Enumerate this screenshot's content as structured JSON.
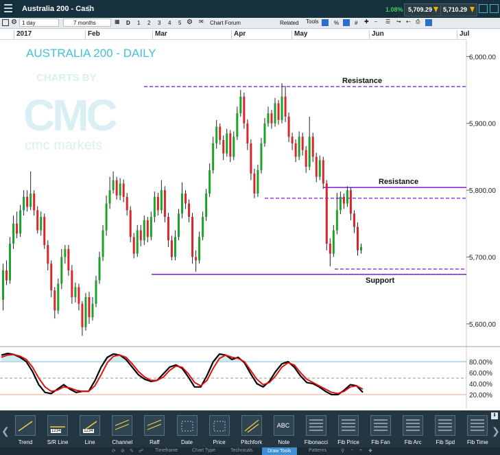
{
  "header": {
    "title": "Australia 200 - Cash",
    "change": "1.08%",
    "sell_price": "5,709.29",
    "buy_price": "5,710.29"
  },
  "toolbar": {
    "interval": "1 day",
    "range": "7 months",
    "d_label": "D",
    "periods": [
      "1",
      "2",
      "3",
      "4",
      "5"
    ],
    "chart_forum": "Chart Forum",
    "related": "Related",
    "tools": "Tools",
    "percent": "%",
    "hash": "#"
  },
  "months": [
    "2017",
    "Feb",
    "Mar",
    "Apr",
    "May",
    "Jun",
    "Jul"
  ],
  "watermark": {
    "charts_by": "CHARTS BY",
    "logo": "CMC",
    "brand": "cmc markets"
  },
  "chart_data": {
    "type": "candlestick",
    "title": "AUSTRALIA 200 - DAILY",
    "y_ticks": [
      "6,000.00",
      "5,900.00",
      "5,800.00",
      "5,700.00",
      "5,600.00"
    ],
    "y_tick_values": [
      6000,
      5900,
      5800,
      5700,
      5600
    ],
    "y_range": [
      5565,
      6025
    ],
    "candles": [
      [
        5636,
        5680,
        5620,
        5690
      ],
      [
        5680,
        5665,
        5658,
        5695
      ],
      [
        5665,
        5720,
        5660,
        5730
      ],
      [
        5720,
        5750,
        5712,
        5762
      ],
      [
        5750,
        5735,
        5728,
        5768
      ],
      [
        5735,
        5770,
        5730,
        5778
      ],
      [
        5770,
        5790,
        5762,
        5800
      ],
      [
        5790,
        5775,
        5768,
        5800
      ],
      [
        5775,
        5795,
        5770,
        5828
      ],
      [
        5795,
        5770,
        5762,
        5800
      ],
      [
        5770,
        5740,
        5735,
        5776
      ],
      [
        5740,
        5760,
        5732,
        5768
      ],
      [
        5760,
        5718,
        5712,
        5765
      ],
      [
        5718,
        5690,
        5680,
        5725
      ],
      [
        5690,
        5650,
        5640,
        5695
      ],
      [
        5650,
        5620,
        5608,
        5655
      ],
      [
        5620,
        5660,
        5615,
        5668
      ],
      [
        5660,
        5700,
        5652,
        5712
      ],
      [
        5700,
        5712,
        5690,
        5718
      ],
      [
        5712,
        5680,
        5672,
        5718
      ],
      [
        5680,
        5640,
        5630,
        5688
      ],
      [
        5640,
        5655,
        5632,
        5662
      ],
      [
        5655,
        5630,
        5620,
        5660
      ],
      [
        5630,
        5595,
        5582,
        5634
      ],
      [
        5595,
        5640,
        5590,
        5646
      ],
      [
        5640,
        5610,
        5600,
        5648
      ],
      [
        5610,
        5630,
        5605,
        5640
      ],
      [
        5630,
        5665,
        5625,
        5672
      ],
      [
        5665,
        5700,
        5660,
        5708
      ],
      [
        5700,
        5740,
        5694,
        5748
      ],
      [
        5740,
        5780,
        5732,
        5792
      ],
      [
        5780,
        5800,
        5772,
        5820
      ],
      [
        5800,
        5815,
        5795,
        5828
      ],
      [
        5815,
        5792,
        5786,
        5820
      ],
      [
        5792,
        5810,
        5785,
        5818
      ],
      [
        5810,
        5790,
        5782,
        5816
      ],
      [
        5790,
        5770,
        5762,
        5796
      ],
      [
        5770,
        5730,
        5722,
        5776
      ],
      [
        5730,
        5705,
        5698,
        5736
      ],
      [
        5705,
        5740,
        5700,
        5748
      ],
      [
        5740,
        5725,
        5716,
        5748
      ],
      [
        5725,
        5755,
        5718,
        5762
      ],
      [
        5755,
        5730,
        5722,
        5760
      ],
      [
        5730,
        5760,
        5725,
        5768
      ],
      [
        5760,
        5790,
        5752,
        5798
      ],
      [
        5790,
        5770,
        5762,
        5796
      ],
      [
        5770,
        5800,
        5765,
        5815
      ],
      [
        5800,
        5760,
        5752,
        5806
      ],
      [
        5760,
        5725,
        5715,
        5766
      ],
      [
        5725,
        5700,
        5695,
        5732
      ],
      [
        5700,
        5730,
        5695,
        5740
      ],
      [
        5730,
        5765,
        5725,
        5772
      ],
      [
        5765,
        5795,
        5758,
        5812
      ],
      [
        5795,
        5780,
        5772,
        5800
      ],
      [
        5780,
        5760,
        5752,
        5786
      ],
      [
        5760,
        5700,
        5690,
        5766
      ],
      [
        5700,
        5695,
        5678,
        5710
      ],
      [
        5695,
        5730,
        5690,
        5738
      ],
      [
        5730,
        5760,
        5725,
        5768
      ],
      [
        5760,
        5795,
        5754,
        5802
      ],
      [
        5795,
        5830,
        5790,
        5840
      ],
      [
        5830,
        5870,
        5825,
        5880
      ],
      [
        5870,
        5895,
        5862,
        5905
      ],
      [
        5895,
        5875,
        5868,
        5900
      ],
      [
        5875,
        5855,
        5845,
        5882
      ],
      [
        5855,
        5885,
        5850,
        5892
      ],
      [
        5885,
        5850,
        5842,
        5890
      ],
      [
        5850,
        5880,
        5845,
        5888
      ],
      [
        5880,
        5915,
        5875,
        5925
      ],
      [
        5915,
        5940,
        5910,
        5950
      ],
      [
        5940,
        5900,
        5892,
        5946
      ],
      [
        5900,
        5870,
        5860,
        5906
      ],
      [
        5870,
        5825,
        5815,
        5876
      ],
      [
        5825,
        5795,
        5788,
        5832
      ],
      [
        5795,
        5830,
        5790,
        5838
      ],
      [
        5830,
        5870,
        5825,
        5878
      ],
      [
        5870,
        5900,
        5865,
        5908
      ],
      [
        5900,
        5915,
        5895,
        5925
      ],
      [
        5915,
        5900,
        5892,
        5920
      ],
      [
        5900,
        5930,
        5895,
        5938
      ],
      [
        5930,
        5905,
        5898,
        5935
      ],
      [
        5905,
        5940,
        5900,
        5960
      ],
      [
        5940,
        5910,
        5902,
        5956
      ],
      [
        5910,
        5880,
        5872,
        5916
      ],
      [
        5880,
        5870,
        5860,
        5886
      ],
      [
        5870,
        5850,
        5842,
        5876
      ],
      [
        5850,
        5880,
        5845,
        5888
      ],
      [
        5880,
        5860,
        5852,
        5886
      ],
      [
        5860,
        5835,
        5826,
        5866
      ],
      [
        5835,
        5880,
        5830,
        5910
      ],
      [
        5880,
        5850,
        5842,
        5886
      ],
      [
        5850,
        5820,
        5812,
        5856
      ],
      [
        5820,
        5845,
        5815,
        5852
      ],
      [
        5845,
        5810,
        5802,
        5850
      ],
      [
        5810,
        5720,
        5710,
        5815
      ],
      [
        5720,
        5705,
        5686,
        5728
      ],
      [
        5705,
        5740,
        5700,
        5748
      ],
      [
        5740,
        5770,
        5734,
        5796
      ],
      [
        5770,
        5790,
        5764,
        5798
      ],
      [
        5790,
        5780,
        5772,
        5795
      ],
      [
        5780,
        5800,
        5775,
        5806
      ],
      [
        5800,
        5765,
        5755,
        5804
      ],
      [
        5765,
        5745,
        5736,
        5770
      ],
      [
        5745,
        5710,
        5702,
        5752
      ],
      [
        5710,
        5715,
        5705,
        5720
      ]
    ],
    "levels": [
      {
        "label": "Resistance",
        "value": 5955,
        "style": "dashed"
      },
      {
        "label": "Resistance",
        "value": 5804,
        "style": "solid"
      },
      {
        "label": "",
        "value": 5788,
        "style": "dashed"
      },
      {
        "label": "",
        "value": 5682,
        "style": "dashed"
      },
      {
        "label": "Support",
        "value": 5674,
        "style": "solid"
      }
    ],
    "oscillator": {
      "y_ticks": [
        "80.00%",
        "60.00%",
        "40.00%",
        "20.00%"
      ],
      "y_tick_values": [
        80,
        60,
        40,
        20
      ],
      "k": [
        92,
        95,
        93,
        88,
        80,
        62,
        38,
        24,
        22,
        30,
        38,
        30,
        24,
        26,
        26,
        45,
        70,
        88,
        94,
        92,
        84,
        70,
        56,
        48,
        44,
        46,
        58,
        70,
        74,
        68,
        52,
        34,
        34,
        55,
        80,
        94,
        92,
        84,
        88,
        78,
        58,
        40,
        34,
        44,
        62,
        76,
        80,
        70,
        54,
        42,
        40,
        34,
        26,
        20,
        20,
        28,
        38,
        36,
        24
      ],
      "d": [
        88,
        92,
        93,
        90,
        84,
        70,
        50,
        34,
        26,
        28,
        34,
        32,
        28,
        26,
        26,
        36,
        56,
        78,
        90,
        92,
        88,
        76,
        62,
        52,
        46,
        46,
        52,
        64,
        72,
        70,
        58,
        42,
        36,
        46,
        68,
        86,
        92,
        88,
        86,
        80,
        64,
        48,
        38,
        42,
        54,
        70,
        78,
        74,
        60,
        48,
        42,
        36,
        30,
        24,
        22,
        26,
        34,
        36,
        30
      ]
    }
  },
  "draw_tools": [
    {
      "label": "Trend",
      "icon": "trend-line-icon"
    },
    {
      "label": "S/R Line",
      "icon": "sr-line-icon"
    },
    {
      "label": "Line",
      "icon": "line-icon"
    },
    {
      "label": "Channel",
      "icon": "channel-icon"
    },
    {
      "label": "Raff",
      "icon": "raff-icon"
    },
    {
      "label": "Date",
      "icon": "date-icon"
    },
    {
      "label": "Price",
      "icon": "price-icon"
    },
    {
      "label": "Pitchfork",
      "icon": "pitchfork-icon"
    },
    {
      "label": "Note",
      "icon": "note-icon"
    },
    {
      "label": "Fibonacci",
      "icon": "fibonacci-icon"
    },
    {
      "label": "Fib Price",
      "icon": "fib-price-icon"
    },
    {
      "label": "Fib Fan",
      "icon": "fib-fan-icon"
    },
    {
      "label": "Fib Arc",
      "icon": "fib-arc-icon"
    },
    {
      "label": "Fib Spd",
      "icon": "fib-spd-icon"
    },
    {
      "label": "Fib Time",
      "icon": "fib-time-icon"
    }
  ],
  "tool_tags": {
    "sr_line": "1234",
    "line": "1234",
    "note": "ABC"
  },
  "bottom_tabs": [
    "Timeframe",
    "Chart Type",
    "Technicals",
    "Draw Tools",
    "Patterns"
  ],
  "colors": {
    "up": "#1aa32a",
    "down": "#d9262b",
    "resistance": "#8a2be2",
    "support": "#8a2be2",
    "title": "#3ec3d6",
    "k_line": "#000000",
    "d_line": "#e01010"
  }
}
